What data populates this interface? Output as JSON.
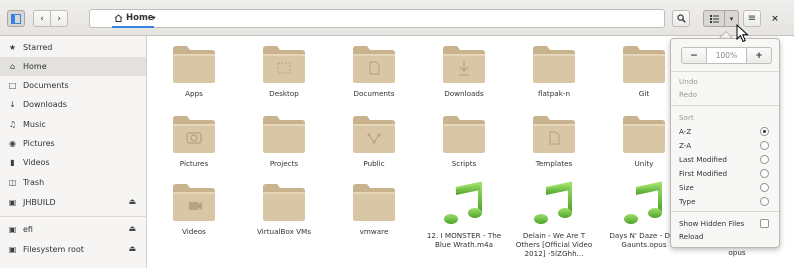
{
  "pathbar": {
    "location": "Home"
  },
  "sidebar": {
    "items": [
      {
        "label": "Starred",
        "icon": "star-icon"
      },
      {
        "label": "Home",
        "icon": "home-icon"
      },
      {
        "label": "Documents",
        "icon": "document-icon"
      },
      {
        "label": "Downloads",
        "icon": "download-icon"
      },
      {
        "label": "Music",
        "icon": "music-icon"
      },
      {
        "label": "Pictures",
        "icon": "camera-icon"
      },
      {
        "label": "Videos",
        "icon": "video-icon"
      },
      {
        "label": "Trash",
        "icon": "trash-icon"
      },
      {
        "label": "JHBUILD",
        "icon": "drive-icon"
      },
      {
        "label": "efi",
        "icon": "drive-icon"
      },
      {
        "label": "Filesystem root",
        "icon": "drive-icon"
      }
    ]
  },
  "files": [
    {
      "name": "Apps",
      "kind": "folder"
    },
    {
      "name": "Desktop",
      "kind": "folder"
    },
    {
      "name": "Documents",
      "kind": "folder"
    },
    {
      "name": "Downloads",
      "kind": "folder"
    },
    {
      "name": "flatpak-n",
      "kind": "folder"
    },
    {
      "name": "Git",
      "kind": "folder"
    },
    {
      "name": "Pictures",
      "kind": "folder"
    },
    {
      "name": "Projects",
      "kind": "folder"
    },
    {
      "name": "Public",
      "kind": "folder"
    },
    {
      "name": "Scripts",
      "kind": "folder"
    },
    {
      "name": "Templates",
      "kind": "folder"
    },
    {
      "name": "Unity",
      "kind": "folder"
    },
    {
      "name": "Videos",
      "kind": "folder"
    },
    {
      "name": "VirtualBox VMs",
      "kind": "folder"
    },
    {
      "name": "vmware",
      "kind": "folder"
    },
    {
      "name": "12. I MONSTER - The Blue Wrath.m4a",
      "kind": "audio"
    },
    {
      "name": "Delain - We Are T Others [Official Video 2012] -5lZGhh...",
      "kind": "audio"
    },
    {
      "name": "Days N' Daze - Day Gaunts.opus",
      "kind": "audio"
    }
  ],
  "partial_label": "opus",
  "view_menu": {
    "zoom_out": "−",
    "zoom_value": "100%",
    "zoom_in": "+",
    "undo": "Undo",
    "redo": "Redo",
    "sort_heading": "Sort",
    "sort_options": [
      {
        "label": "A-Z",
        "checked": true
      },
      {
        "label": "Z-A",
        "checked": false
      },
      {
        "label": "Last Modified",
        "checked": false
      },
      {
        "label": "First Modified",
        "checked": false
      },
      {
        "label": "Size",
        "checked": false
      },
      {
        "label": "Type",
        "checked": false
      }
    ],
    "show_hidden": "Show Hidden Files",
    "reload": "Reload"
  },
  "colors": {
    "accent": "#3584e4",
    "folder": "#d9c6a5",
    "folder_dark": "#c4ad89",
    "music": "#7dc442"
  }
}
